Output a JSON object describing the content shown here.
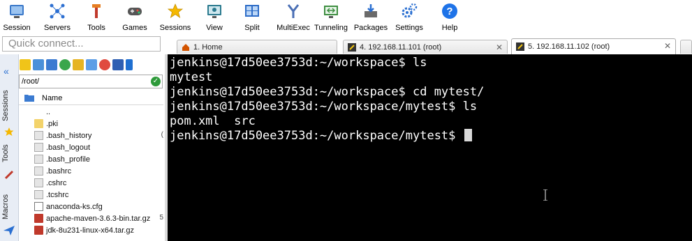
{
  "toolbar": {
    "items": [
      {
        "label": "Session",
        "icon": "session-icon"
      },
      {
        "label": "Servers",
        "icon": "servers-icon"
      },
      {
        "label": "Tools",
        "icon": "tools-icon"
      },
      {
        "label": "Games",
        "icon": "games-icon"
      },
      {
        "label": "Sessions",
        "icon": "star-icon"
      },
      {
        "label": "View",
        "icon": "view-icon"
      },
      {
        "label": "Split",
        "icon": "split-icon"
      },
      {
        "label": "MultiExec",
        "icon": "multiexec-icon"
      },
      {
        "label": "Tunneling",
        "icon": "tunneling-icon"
      },
      {
        "label": "Packages",
        "icon": "packages-icon"
      },
      {
        "label": "Settings",
        "icon": "settings-icon"
      },
      {
        "label": "Help",
        "icon": "help-icon"
      }
    ]
  },
  "quick_connect": {
    "placeholder": "Quick connect..."
  },
  "tabs": [
    {
      "label": "1. Home",
      "icon": "home-icon",
      "active": false
    },
    {
      "label": "4. 192.168.11.101 (root)",
      "icon": "ssh-icon",
      "active": false
    },
    {
      "label": "5. 192.168.11.102 (root)",
      "icon": "ssh-icon",
      "active": true
    }
  ],
  "sidebar": {
    "vertical_tabs": [
      "Sessions",
      "Tools",
      "Macros"
    ],
    "path": "/root/",
    "column_name": "Name",
    "files": [
      {
        "name": "..",
        "type": "folder-up"
      },
      {
        "name": ".pki",
        "type": "folder"
      },
      {
        "name": ".bash_history",
        "type": "file"
      },
      {
        "name": ".bash_logout",
        "type": "file"
      },
      {
        "name": ".bash_profile",
        "type": "file"
      },
      {
        "name": ".bashrc",
        "type": "file"
      },
      {
        "name": ".cshrc",
        "type": "file"
      },
      {
        "name": ".tcshrc",
        "type": "file"
      },
      {
        "name": "anaconda-ks.cfg",
        "type": "file"
      },
      {
        "name": "apache-maven-3.6.3-bin.tar.gz",
        "type": "archive"
      },
      {
        "name": "jdk-8u231-linux-x64.tar.gz",
        "type": "archive"
      }
    ]
  },
  "terminal": {
    "lines": [
      "jenkins@17d50ee3753d:~/workspace$ ls",
      "mytest",
      "jenkins@17d50ee3753d:~/workspace$ cd mytest/",
      "jenkins@17d50ee3753d:~/workspace/mytest$ ls",
      "pom.xml  src",
      "jenkins@17d50ee3753d:~/workspace/mytest$ "
    ]
  },
  "colors": {
    "terminal_bg": "#000000",
    "terminal_fg": "#ffffff",
    "sidebar_strip": "#e8edf5"
  }
}
